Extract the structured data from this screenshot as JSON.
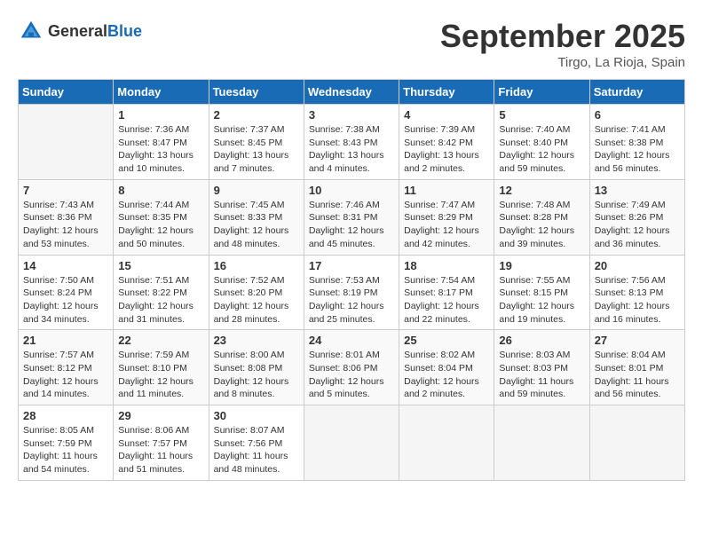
{
  "header": {
    "logo_general": "General",
    "logo_blue": "Blue",
    "month_title": "September 2025",
    "location": "Tirgo, La Rioja, Spain"
  },
  "weekdays": [
    "Sunday",
    "Monday",
    "Tuesday",
    "Wednesday",
    "Thursday",
    "Friday",
    "Saturday"
  ],
  "weeks": [
    [
      {
        "day": "",
        "info": ""
      },
      {
        "day": "1",
        "info": "Sunrise: 7:36 AM\nSunset: 8:47 PM\nDaylight: 13 hours\nand 10 minutes."
      },
      {
        "day": "2",
        "info": "Sunrise: 7:37 AM\nSunset: 8:45 PM\nDaylight: 13 hours\nand 7 minutes."
      },
      {
        "day": "3",
        "info": "Sunrise: 7:38 AM\nSunset: 8:43 PM\nDaylight: 13 hours\nand 4 minutes."
      },
      {
        "day": "4",
        "info": "Sunrise: 7:39 AM\nSunset: 8:42 PM\nDaylight: 13 hours\nand 2 minutes."
      },
      {
        "day": "5",
        "info": "Sunrise: 7:40 AM\nSunset: 8:40 PM\nDaylight: 12 hours\nand 59 minutes."
      },
      {
        "day": "6",
        "info": "Sunrise: 7:41 AM\nSunset: 8:38 PM\nDaylight: 12 hours\nand 56 minutes."
      }
    ],
    [
      {
        "day": "7",
        "info": "Sunrise: 7:43 AM\nSunset: 8:36 PM\nDaylight: 12 hours\nand 53 minutes."
      },
      {
        "day": "8",
        "info": "Sunrise: 7:44 AM\nSunset: 8:35 PM\nDaylight: 12 hours\nand 50 minutes."
      },
      {
        "day": "9",
        "info": "Sunrise: 7:45 AM\nSunset: 8:33 PM\nDaylight: 12 hours\nand 48 minutes."
      },
      {
        "day": "10",
        "info": "Sunrise: 7:46 AM\nSunset: 8:31 PM\nDaylight: 12 hours\nand 45 minutes."
      },
      {
        "day": "11",
        "info": "Sunrise: 7:47 AM\nSunset: 8:29 PM\nDaylight: 12 hours\nand 42 minutes."
      },
      {
        "day": "12",
        "info": "Sunrise: 7:48 AM\nSunset: 8:28 PM\nDaylight: 12 hours\nand 39 minutes."
      },
      {
        "day": "13",
        "info": "Sunrise: 7:49 AM\nSunset: 8:26 PM\nDaylight: 12 hours\nand 36 minutes."
      }
    ],
    [
      {
        "day": "14",
        "info": "Sunrise: 7:50 AM\nSunset: 8:24 PM\nDaylight: 12 hours\nand 34 minutes."
      },
      {
        "day": "15",
        "info": "Sunrise: 7:51 AM\nSunset: 8:22 PM\nDaylight: 12 hours\nand 31 minutes."
      },
      {
        "day": "16",
        "info": "Sunrise: 7:52 AM\nSunset: 8:20 PM\nDaylight: 12 hours\nand 28 minutes."
      },
      {
        "day": "17",
        "info": "Sunrise: 7:53 AM\nSunset: 8:19 PM\nDaylight: 12 hours\nand 25 minutes."
      },
      {
        "day": "18",
        "info": "Sunrise: 7:54 AM\nSunset: 8:17 PM\nDaylight: 12 hours\nand 22 minutes."
      },
      {
        "day": "19",
        "info": "Sunrise: 7:55 AM\nSunset: 8:15 PM\nDaylight: 12 hours\nand 19 minutes."
      },
      {
        "day": "20",
        "info": "Sunrise: 7:56 AM\nSunset: 8:13 PM\nDaylight: 12 hours\nand 16 minutes."
      }
    ],
    [
      {
        "day": "21",
        "info": "Sunrise: 7:57 AM\nSunset: 8:12 PM\nDaylight: 12 hours\nand 14 minutes."
      },
      {
        "day": "22",
        "info": "Sunrise: 7:59 AM\nSunset: 8:10 PM\nDaylight: 12 hours\nand 11 minutes."
      },
      {
        "day": "23",
        "info": "Sunrise: 8:00 AM\nSunset: 8:08 PM\nDaylight: 12 hours\nand 8 minutes."
      },
      {
        "day": "24",
        "info": "Sunrise: 8:01 AM\nSunset: 8:06 PM\nDaylight: 12 hours\nand 5 minutes."
      },
      {
        "day": "25",
        "info": "Sunrise: 8:02 AM\nSunset: 8:04 PM\nDaylight: 12 hours\nand 2 minutes."
      },
      {
        "day": "26",
        "info": "Sunrise: 8:03 AM\nSunset: 8:03 PM\nDaylight: 11 hours\nand 59 minutes."
      },
      {
        "day": "27",
        "info": "Sunrise: 8:04 AM\nSunset: 8:01 PM\nDaylight: 11 hours\nand 56 minutes."
      }
    ],
    [
      {
        "day": "28",
        "info": "Sunrise: 8:05 AM\nSunset: 7:59 PM\nDaylight: 11 hours\nand 54 minutes."
      },
      {
        "day": "29",
        "info": "Sunrise: 8:06 AM\nSunset: 7:57 PM\nDaylight: 11 hours\nand 51 minutes."
      },
      {
        "day": "30",
        "info": "Sunrise: 8:07 AM\nSunset: 7:56 PM\nDaylight: 11 hours\nand 48 minutes."
      },
      {
        "day": "",
        "info": ""
      },
      {
        "day": "",
        "info": ""
      },
      {
        "day": "",
        "info": ""
      },
      {
        "day": "",
        "info": ""
      }
    ]
  ]
}
